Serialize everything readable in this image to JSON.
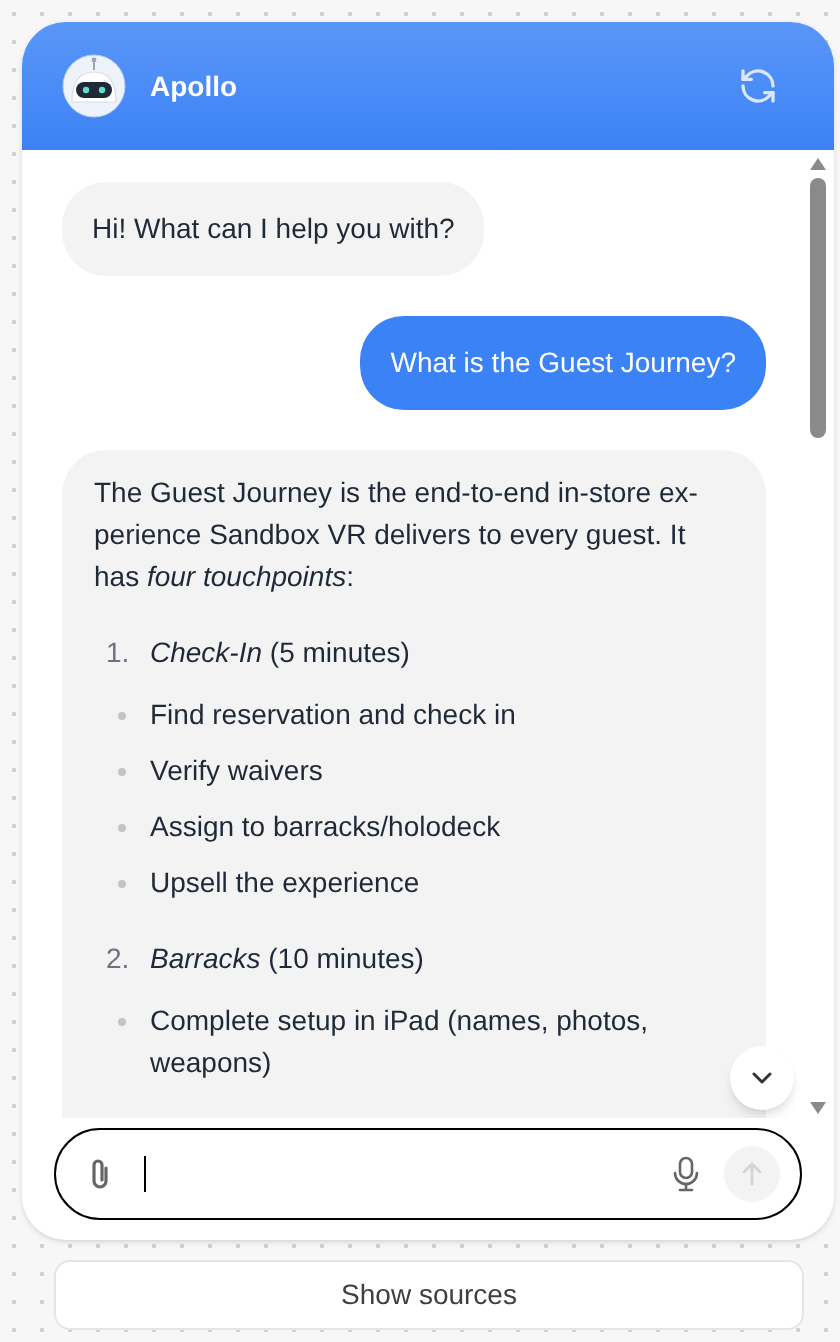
{
  "header": {
    "title": "Apollo"
  },
  "messages": [
    {
      "kind": "assistant",
      "text": "Hi! What can I help you with?"
    },
    {
      "kind": "user",
      "text": "What is the Guest Journey?"
    },
    {
      "kind": "assistant",
      "text": "The Guest Journey is the end-to-end in-store ex-perience Sandbox VR delivers to every guest. It has *four touchpoints*:",
      "touchpoints": [
        {
          "number": "1.",
          "text": "*Check-In* (5 minutes)",
          "bullets": [
            "Find reservation and check in",
            "Verify waivers",
            "Assign to barracks/holodeck",
            "Upsell the experience"
          ]
        },
        {
          "number": "2.",
          "text": "*Barracks* (10 minutes)",
          "bullets": [
            "Complete setup in iPad (names, photos, weapons)"
          ]
        }
      ]
    }
  ],
  "sources_button": {
    "label": "Show sources"
  }
}
